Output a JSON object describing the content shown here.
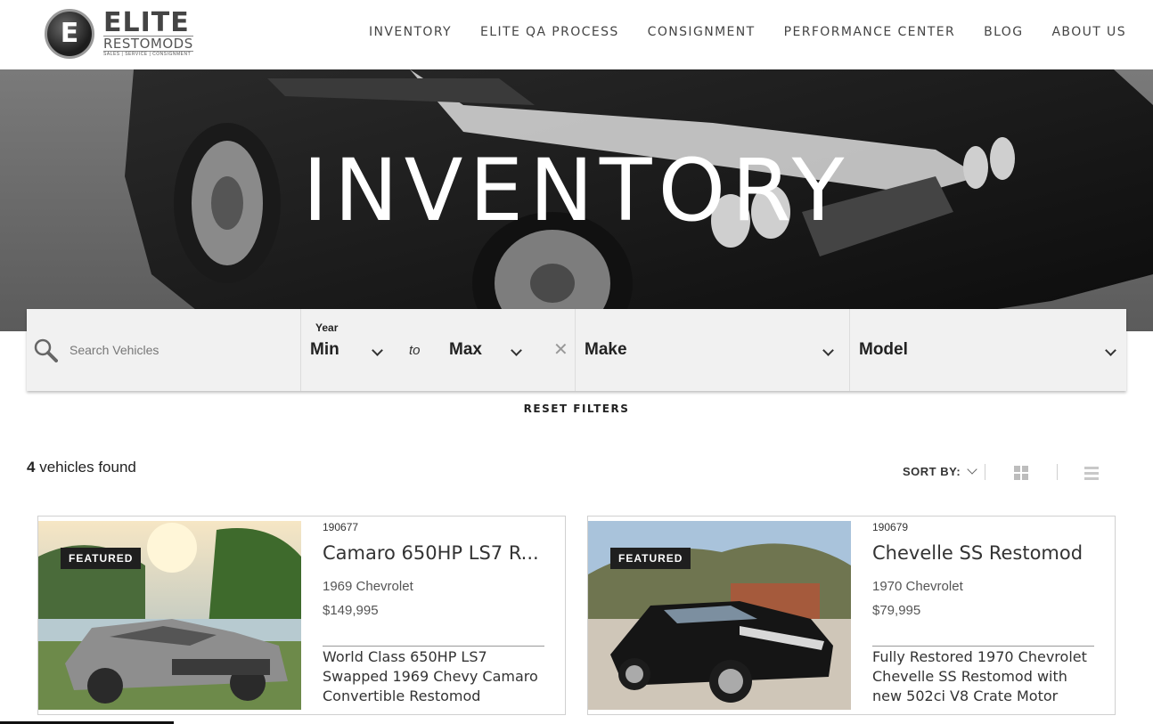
{
  "brand": {
    "logo_mark": "E",
    "name_line1": "ELITE",
    "name_line2": "RESTOMODS",
    "tagline": "SALES | SERVICE | CONSIGNMENT"
  },
  "nav": {
    "items": [
      "INVENTORY",
      "ELITE QA PROCESS",
      "CONSIGNMENT",
      "PERFORMANCE CENTER",
      "BLOG",
      "ABOUT US"
    ]
  },
  "hero": {
    "title": "INVENTORY"
  },
  "filters": {
    "search_placeholder": "Search Vehicles",
    "year_label": "Year",
    "year_min": "Min",
    "to_text": "to",
    "year_max": "Max",
    "clear_symbol": "✕",
    "make": "Make",
    "model": "Model",
    "reset_label": "RESET FILTERS"
  },
  "results": {
    "count": "4",
    "count_suffix": " vehicles found",
    "sort_label": "SORT BY:"
  },
  "vehicles": [
    {
      "badge": "FEATURED",
      "stock": "190677",
      "title": "Camaro 650HP LS7 R...",
      "subtitle": "1969 Chevrolet",
      "price": "$149,995",
      "description": "World Class 650HP LS7 Swapped 1969 Chevy Camaro Convertible Restomod"
    },
    {
      "badge": "FEATURED",
      "stock": "190679",
      "title": "Chevelle SS Restomod",
      "subtitle": "1970 Chevrolet",
      "price": "$79,995",
      "description": "Fully Restored 1970 Chevrolet Chevelle SS Restomod with new 502ci V8 Crate Motor"
    }
  ],
  "icons": {
    "search": "search-icon",
    "grid_view": "grid-view-icon",
    "list_view": "list-view-icon",
    "dropdown": "chevron-down-icon"
  }
}
